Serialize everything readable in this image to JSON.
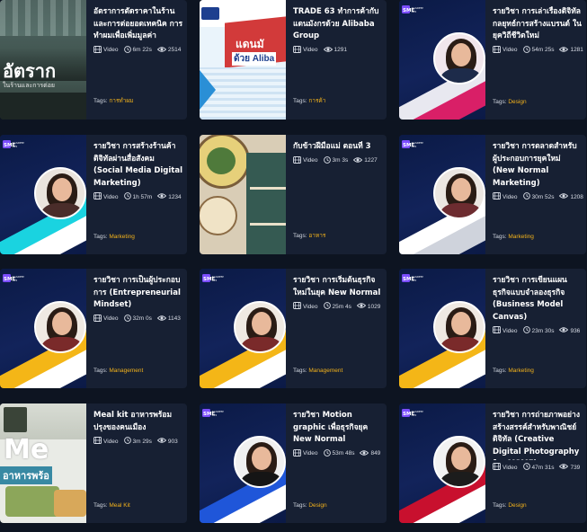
{
  "cards": [
    {
      "title": "อัตราการตัดราคาในร้าน และการต่อยอดเทคนิค การทำผมเพื่อเพิ่มมูลค่า",
      "type": "Video",
      "duration": "6m 22s",
      "views": "2514",
      "tags_label": "Tags:",
      "tag": "การทำผม",
      "thumb": "photo-salon",
      "thumb_text": "อัตราก",
      "thumb_sub": "ในร้านและการต่อย"
    },
    {
      "title": "TRADE 63 ทำการค้ากับ แดนมังกรด้วย Alibaba Group",
      "type": "Video",
      "duration": "",
      "views": "1291",
      "tags_label": "Tags:",
      "tag": "การค้า",
      "thumb": "trade-poster",
      "thumb_text": "แดนมั",
      "thumb_sub": "ด้วย Aliba"
    },
    {
      "title": "รายวิชา การเล่าเรื่องดิจิทัล กลยุทธ์การสร้างแบรนด์ ในยุควิถีชีวิตใหม่",
      "type": "Video",
      "duration": "54m 25s",
      "views": "1281",
      "tags_label": "Tags:",
      "tag": "Design",
      "thumb": "sme-pink"
    },
    {
      "title": "รายวิชา การสร้างร้านค้า ดิจิทัลผ่านสื่อสังคม (Social Media Digital Marketing)",
      "type": "Video",
      "duration": "1h 57m",
      "views": "1234",
      "tags_label": "Tags:",
      "tag": "Marketing",
      "thumb": "sme-cyan"
    },
    {
      "title": "กับข้าวฝีมือแม่ ตอนที่ 3",
      "type": "Video",
      "duration": "3m 3s",
      "views": "1227",
      "tags_label": "Tags:",
      "tag": "อาหาร",
      "thumb": "food"
    },
    {
      "title": "รายวิชา การตลาดสำหรับ ผู้ประกอบการยุคใหม่ (New Normal Marketing)",
      "type": "Video",
      "duration": "30m 52s",
      "views": "1208",
      "tags_label": "Tags:",
      "tag": "Marketing",
      "thumb": "sme-white"
    },
    {
      "title": "รายวิชา การเป็นผู้ประกอบ การ (Entrepreneurial Mindset)",
      "type": "Video",
      "duration": "32m 0s",
      "views": "1143",
      "tags_label": "Tags:",
      "tag": "Management",
      "thumb": "sme-yellow"
    },
    {
      "title": "รายวิชา การเริ่มต้นธุรกิจ ใหม่ในยุค New Normal",
      "type": "Video",
      "duration": "25m 4s",
      "views": "1029",
      "tags_label": "Tags:",
      "tag": "Management",
      "thumb": "sme-yellow"
    },
    {
      "title": "รายวิชา การเขียนแผน ธุรกิจแบบจำลองธุรกิจ (Business Model Canvas)",
      "type": "Video",
      "duration": "23m 30s",
      "views": "936",
      "tags_label": "Tags:",
      "tag": "Marketing",
      "thumb": "sme-yellow"
    },
    {
      "title": "Meal kit อาหารพร้อม ปรุงของคนเมือง",
      "type": "Video",
      "duration": "3m 29s",
      "views": "903",
      "tags_label": "Tags:",
      "tag": "Meal Kit",
      "thumb": "meal",
      "thumb_text": "Me",
      "thumb_sub": "อาหารพร้อ"
    },
    {
      "title": "รายวิชา Motion graphic เพื่อธุรกิจยุค New Normal",
      "type": "Video",
      "duration": "53m 48s",
      "views": "849",
      "tags_label": "Tags:",
      "tag": "Design",
      "thumb": "sme-blue"
    },
    {
      "title": "รายวิชา การถ่ายภาพอย่าง สร้างสรรค์สำหรับพาณิชย์ ดิจิทัล (Creative Digital Photography for MSME)",
      "type": "Video",
      "duration": "47m 31s",
      "views": "739",
      "tags_label": "Tags:",
      "tag": "Design",
      "thumb": "sme-red"
    }
  ],
  "logo": {
    "l1": "SME",
    "l2": "ACADEMY",
    "l3": "365"
  },
  "colors": {
    "accent": "#f3b21b",
    "card_bg": "#172033",
    "page_bg": "#0d1421"
  },
  "icons": {
    "video": "video-icon",
    "clock": "clock-icon",
    "eye": "eye-icon"
  }
}
